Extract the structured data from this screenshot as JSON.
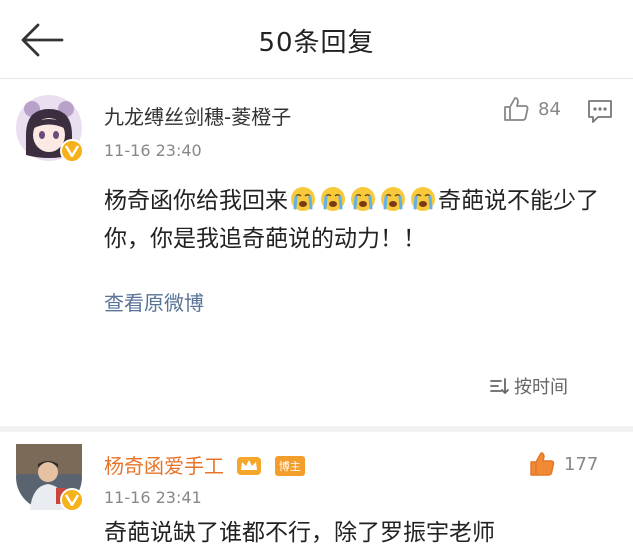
{
  "header": {
    "title": "50条回复",
    "back_icon": "arrow-left-icon"
  },
  "comments": [
    {
      "username": "九龙缚丝剑穗-菱橙子",
      "time": "11-16 23:40",
      "likes": "84",
      "verified_badge": "v-badge-icon",
      "text_before": "杨奇函你给我回来",
      "emoji_name": "crying-emoji-icon",
      "emoji_count": 5,
      "text_after": "奇葩说不能少了你，你是我追奇葩说的动力！！",
      "view_original_label": "查看原微博",
      "sort_label": "按时间"
    },
    {
      "username": "杨奇函爱手工",
      "time": "11-16 23:41",
      "likes": "177",
      "liked": true,
      "blogger_tag": "博主",
      "text": "奇葩说缺了谁都不行，除了罗振宇老师"
    }
  ],
  "colors": {
    "accent_orange": "#e8742a",
    "link_blue": "#5a7396",
    "badge_gold": "#f6b21a"
  }
}
